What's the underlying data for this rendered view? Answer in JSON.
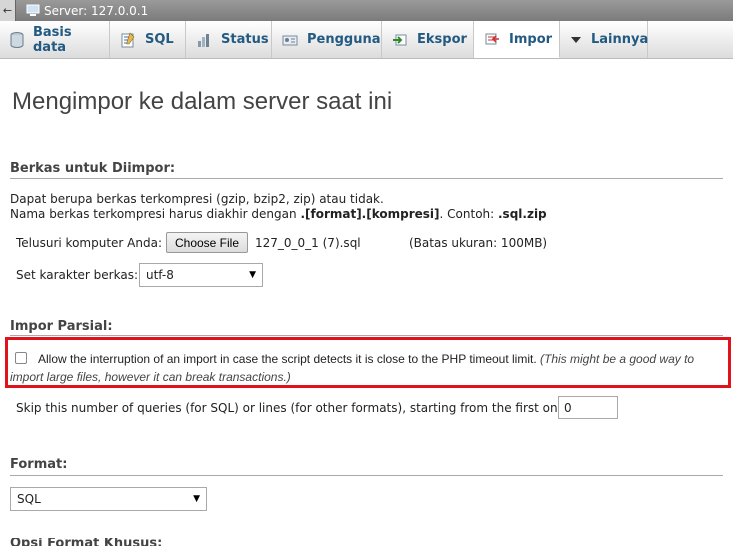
{
  "serverbar": {
    "title": "Server: 127.0.0.1",
    "back_glyph": "←"
  },
  "tabs": [
    {
      "label": "Basis data",
      "icon": "database-icon"
    },
    {
      "label": "SQL",
      "icon": "sql-icon"
    },
    {
      "label": "Status",
      "icon": "status-icon"
    },
    {
      "label": "Pengguna",
      "icon": "users-icon"
    },
    {
      "label": "Ekspor",
      "icon": "export-icon"
    },
    {
      "label": "Impor",
      "icon": "import-icon",
      "active": true
    },
    {
      "label": "Lainnya",
      "icon": "chevron-down-icon"
    }
  ],
  "main": {
    "title": "Mengimpor ke dalam server saat ini",
    "file_section": {
      "legend": "Berkas untuk Diimpor:",
      "desc1": "Dapat berupa berkas terkompresi (gzip, bzip2, zip) atau tidak.",
      "desc2_prefix": "Nama berkas terkompresi harus diakhir dengan ",
      "desc2_bold": ".[format].[kompresi]",
      "desc2_mid": ". Contoh: ",
      "desc2_example": ".sql.zip",
      "browse_label": "Telusuri komputer Anda:",
      "choose_button": "Choose File",
      "file_name": "127_0_0_1 (7).sql",
      "max_size": "(Batas ukuran: 100MB)",
      "charset_label": "Set karakter berkas:",
      "charset_value": "utf-8"
    },
    "partial_section": {
      "legend": "Impor Parsial:",
      "allow_interrupt_text": "Allow the interruption of an import in case the script detects it is close to the PHP timeout limit.",
      "allow_interrupt_hint": "(This might be a good way to import large files, however it can break transactions.)",
      "allow_interrupt_checked": false,
      "skip_label": "Skip this number of queries (for SQL) or lines (for other formats), starting from the first one:",
      "skip_value": "0"
    },
    "format_section": {
      "legend": "Format:",
      "format_value": "SQL"
    },
    "next_heading_cut": "Opsi Format Khusus:"
  },
  "colors": {
    "highlight_border": "#e0121b",
    "tab_text": "#235a81"
  }
}
